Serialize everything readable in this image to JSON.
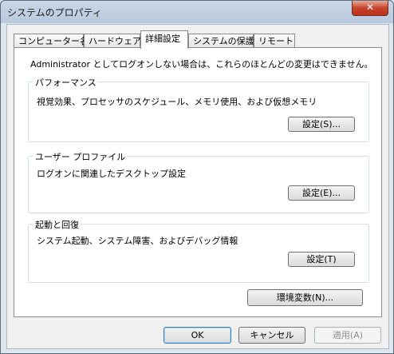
{
  "window": {
    "title": "システムのプロパティ",
    "close_label": "✕"
  },
  "tabs": [
    {
      "label": "コンピューター名"
    },
    {
      "label": "ハードウェア"
    },
    {
      "label": "詳細設定"
    },
    {
      "label": "システムの保護"
    },
    {
      "label": "リモート"
    }
  ],
  "active_tab": "詳細設定",
  "panel": {
    "notice": "Administrator としてログオンしない場合は、これらのほとんどの変更はできません。",
    "performance": {
      "label": "パフォーマンス",
      "description": "視覚効果、プロセッサのスケジュール、メモリ使用、および仮想メモリ",
      "button": "設定(S)..."
    },
    "user_profiles": {
      "label": "ユーザー プロファイル",
      "description": "ログオンに関連したデスクトップ設定",
      "button": "設定(E)..."
    },
    "startup_recovery": {
      "label": "起動と回復",
      "description": "システム起動、システム障害、およびデバッグ情報",
      "button": "設定(T)"
    },
    "env_button": "環境変数(N)..."
  },
  "buttons": {
    "ok": "OK",
    "cancel": "キャンセル",
    "apply": "適用(A)"
  }
}
